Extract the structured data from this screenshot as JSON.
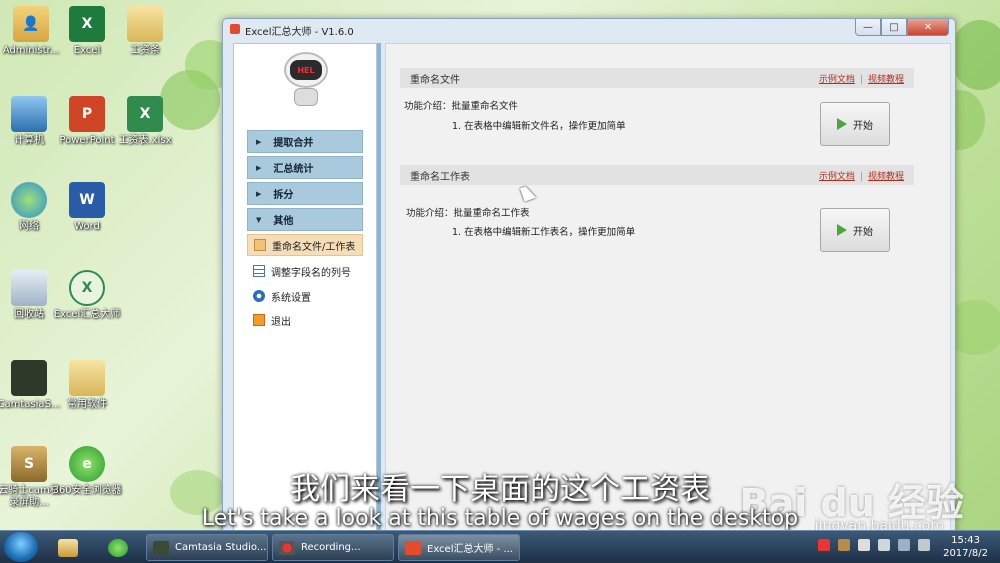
{
  "desktop": {
    "icons": [
      {
        "label": "Administr...",
        "glyph": "👤"
      },
      {
        "label": "Excel",
        "glyph": "X"
      },
      {
        "label": "工资条",
        "glyph": ""
      },
      {
        "label": "计算机",
        "glyph": ""
      },
      {
        "label": "PowerPoint",
        "glyph": "P"
      },
      {
        "label": "工资表.xlsx",
        "glyph": "X"
      },
      {
        "label": "网络",
        "glyph": ""
      },
      {
        "label": "Word",
        "glyph": "W"
      },
      {
        "label": "回收站",
        "glyph": ""
      },
      {
        "label": "Excel汇总大师",
        "glyph": "X"
      },
      {
        "label": "CamtasiaS...",
        "glyph": ""
      },
      {
        "label": "常用软件",
        "glyph": ""
      },
      {
        "label": "云骑士cam机录屏助...",
        "glyph": "S"
      },
      {
        "label": "360安全浏览器",
        "glyph": "e"
      }
    ]
  },
  "window": {
    "title": "Excel汇总大师 - V1.6.0",
    "controls": {
      "minimize": "—",
      "maximize": "□",
      "close": "✕"
    }
  },
  "logo_text": "HEL",
  "sidebar": {
    "groups": [
      {
        "label": "提取合并",
        "arrow": "▶"
      },
      {
        "label": "汇总统计",
        "arrow": "▶"
      },
      {
        "label": "拆分",
        "arrow": "▶"
      },
      {
        "label": "其他",
        "arrow": "▼"
      }
    ],
    "items": [
      {
        "label": "重命名文件/工作表",
        "icon": "rename-icon"
      },
      {
        "label": "调整字段名的列号",
        "icon": "table-icon"
      },
      {
        "label": "系统设置",
        "icon": "settings-icon"
      },
      {
        "label": "退出",
        "icon": "exit-icon"
      }
    ]
  },
  "sections": [
    {
      "title": "重命名文件",
      "link_doc": "示例文档",
      "sep": "|",
      "link_video": "视频教程",
      "intro": "功能介绍：批量重命名文件",
      "bullet": "1. 在表格中编辑新文件名，操作更加简单",
      "button": "开始"
    },
    {
      "title": "重命名工作表",
      "link_doc": "示例文档",
      "sep": "|",
      "link_video": "视频教程",
      "intro": "功能介绍：批量重命名工作表",
      "bullet": "1. 在表格中编辑新工作表名，操作更加简单",
      "button": "开始"
    }
  ],
  "subtitles": {
    "cn": "我们来看一下桌面的这个工资表",
    "en": "Let's take a look at this table of wages on the desktop"
  },
  "watermark": {
    "brand": "Bai du 经验",
    "url": "jingyan.baidu.com"
  },
  "taskbar": {
    "tasks": [
      {
        "label": "Camtasia Studio..."
      },
      {
        "label": "Recording..."
      },
      {
        "label": "Excel汇总大师 - ..."
      }
    ],
    "time": "15:43",
    "date": "2017/8/2"
  },
  "colors": {
    "accent_sidebar": "#a9c9dd",
    "active_item": "#f5ddb8",
    "link": "#b0301f",
    "play": "#4aa83a"
  }
}
